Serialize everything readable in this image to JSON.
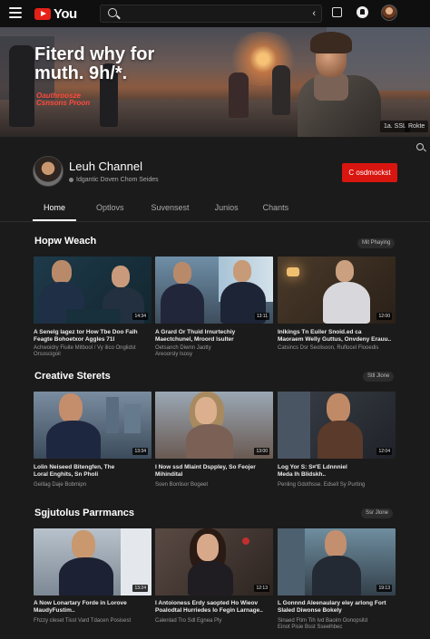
{
  "topbar": {
    "logo_text": "You",
    "search_placeholder": "",
    "icons": [
      "menu-icon",
      "search-icon",
      "mic-icon",
      "create-icon",
      "notifications-icon",
      "avatar"
    ]
  },
  "banner": {
    "title": "Fiterd why for\nmuth. 9h/*.",
    "subtitle": "Oauthroosze\nCsnsons Proon",
    "links": [
      "1a. SSL",
      "Rokte"
    ]
  },
  "channel": {
    "name": "Leuh Channel",
    "meta": "Idgantic Doven Chom Seides",
    "subscribe_label": "C osdmockst"
  },
  "tabs": [
    "Home",
    "Optlovs",
    "Suvensest",
    "Junios",
    "Chants"
  ],
  "sections": [
    {
      "title": "Hopw Weach",
      "sort": "Mit Phaying",
      "videos": [
        {
          "title": "A Senelg lagez tor How Tbe Doo Falh\nFeagte Bohoetxor Aggles 71l",
          "meta": "Achwoidry Fiuite Mitbool / Vy ilico Onglidst\nOrsoscigoil",
          "duration": "14:34"
        },
        {
          "title": "A Grard Or Thuid lrnurtechiy\nMaectchunel, Mroord lsulter",
          "meta": "Oetsanch Diwnn Jaotty\nAreoorsly Isosy",
          "duration": "13:11"
        },
        {
          "title": "Inlkings Tn Euiler Snoid.ed ca\nMaoraem Welly Guttus, Onvdeny Erauu..",
          "meta": "Catsincs Dsr Seolisoon, Ruflocel Flooedis",
          "duration": "12:00"
        }
      ]
    },
    {
      "title": "Creative Sterets",
      "sort": "Stll Jlone",
      "videos": [
        {
          "title": "Lolin Neiseed Bitengfen, The\nLoral Enghits, Sn Pholi",
          "meta": "Geillag Daje Bobmipn",
          "duration": "13:34"
        },
        {
          "title": "I Now ssd Mlaint Dsppley, So Feojer\nMihindital",
          "meta": "Soen Bonlisor Bogeet",
          "duration": "13:00"
        },
        {
          "title": "Log Yor S: S¤'E Ldnnniel\nMeda Ih Blidskh..",
          "meta": "Penling Gdothsse. Edsell Sy Purting",
          "duration": "12:04"
        }
      ]
    },
    {
      "title": "Sgjutolus Parrmancs",
      "sort": "Ssr Jlone",
      "videos": [
        {
          "title": "A Now Lonartary Forde in Lorove\nMaudyFustim..",
          "meta": "Fhzzy cleset Tisst Vard Tdacen Posisest",
          "duration": "13:24"
        },
        {
          "title": "I Antoioness Erdy saopted Ho Wieov\nPoalodtal Hurriedes Io Fegin Larnage..",
          "meta": "Calenlad Tro Sdl Egnea Ply\n",
          "duration": "12:13"
        },
        {
          "title": "L Gonnnd Aleenaulary eley arlong Fort\nSlaled Diwonse Bokely",
          "meta": "Sinaed Ftim Tih Ivd Baoim Oonopsitd\nEinot Pisie Bsst Sseelhbec",
          "duration": "19:13"
        }
      ]
    }
  ],
  "colors": {
    "accent": "#d91510",
    "background": "#1b1b1b",
    "topbar": "#0f0f0f"
  }
}
